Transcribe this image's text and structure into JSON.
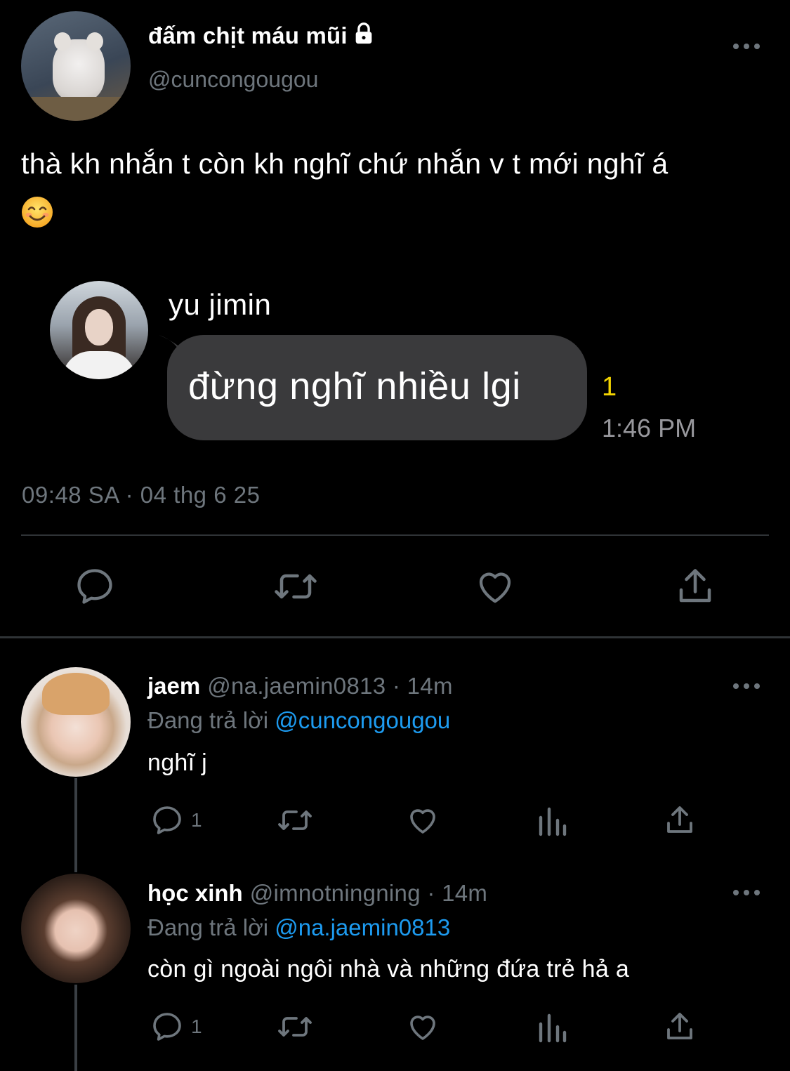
{
  "main_tweet": {
    "display_name": "đấm chịt máu mũi",
    "handle": "@cuncongougou",
    "text": "thà kh nhắn t còn kh nghĩ chứ nhắn v t mới nghĩ á",
    "timestamp": "09:48 SA · 04 thg 6 25",
    "icons": [
      "lock-icon",
      "more-icon",
      "smiling-face-emoji"
    ]
  },
  "chat_image": {
    "sender_name": "yu jimin",
    "message": "đừng nghĩ nhiều lgi",
    "unread_count": "1",
    "time": "1:46 PM"
  },
  "actions": {
    "icons": [
      "reply-icon",
      "retweet-icon",
      "like-icon",
      "share-icon"
    ]
  },
  "replies": [
    {
      "name": "jaem",
      "meta": "@na.jaemin0813 · 14m",
      "replying_prefix": "Đang trả lời",
      "replying_to": "@cuncongougou",
      "text": "nghĩ j",
      "reply_count": "1"
    },
    {
      "name": "học xinh",
      "meta": "@imnotningning · 14m",
      "replying_prefix": "Đang trả lời",
      "replying_to": "@na.jaemin0813",
      "text": "còn gì ngoài ngôi nhà và những đứa trẻ hả a",
      "reply_count": "1"
    }
  ],
  "colors": {
    "background": "#000000",
    "muted": "#6e767d",
    "link": "#1d9bf0",
    "bubble": "#3a3a3c",
    "unread": "#f3d400"
  }
}
